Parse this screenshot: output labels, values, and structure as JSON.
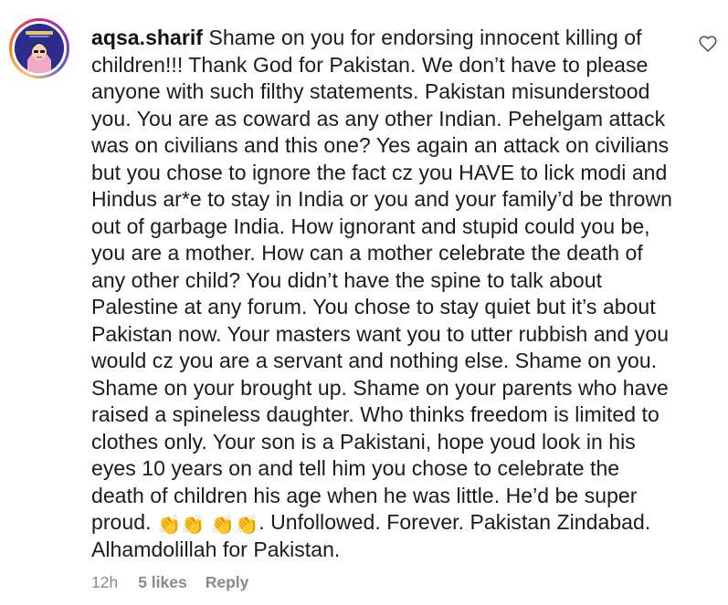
{
  "comment": {
    "username": "aqsa.sharif",
    "avatar": {
      "icon": "profile-avatar",
      "ring_colors": [
        "#fdc468",
        "#fa7e1e",
        "#d62976",
        "#962fbf",
        "#4f5bd5"
      ]
    },
    "text": " Shame on you for endorsing innocent killing of children!!! Thank God for Pakistan. We don’t have to please anyone with such filthy statements. Pakistan misunderstood you. You are as coward as any other Indian. Pehelgam attack was on civilians and this one? Yes again an attack on civilians but you chose to ignore the fact cz you HAVE to lick modi and Hindus ar*e to stay in India or you and your family’d be thrown out of garbage India. How ignorant and stupid could you be, you are a mother. How can a mother celebrate the death of any other child? You didn’t have the spine to talk about Palestine at any forum. You chose to stay quiet but it’s about Pakistan now. Your masters want you to utter rubbish and you would cz you are a servant and nothing else. Shame on you. Shame on your brought up. Shame on your parents who have raised a spineless daughter. Who thinks freedom is limited to clothes only. Your son is a Pakistani, hope youd look in his eyes 10 years on and tell him you chose to celebrate the death of children his age when he was little. He’d be super proud. ",
    "emoji_a": "👏👏",
    "emoji_b": "👏👏",
    "text_after": ". Unfollowed. Forever. Pakistan Zindabad. Alhamdolillah for Pakistan.",
    "timestamp": "12h",
    "likes": "5 likes",
    "reply_label": "Reply",
    "like_icon": "heart-outline-icon"
  }
}
